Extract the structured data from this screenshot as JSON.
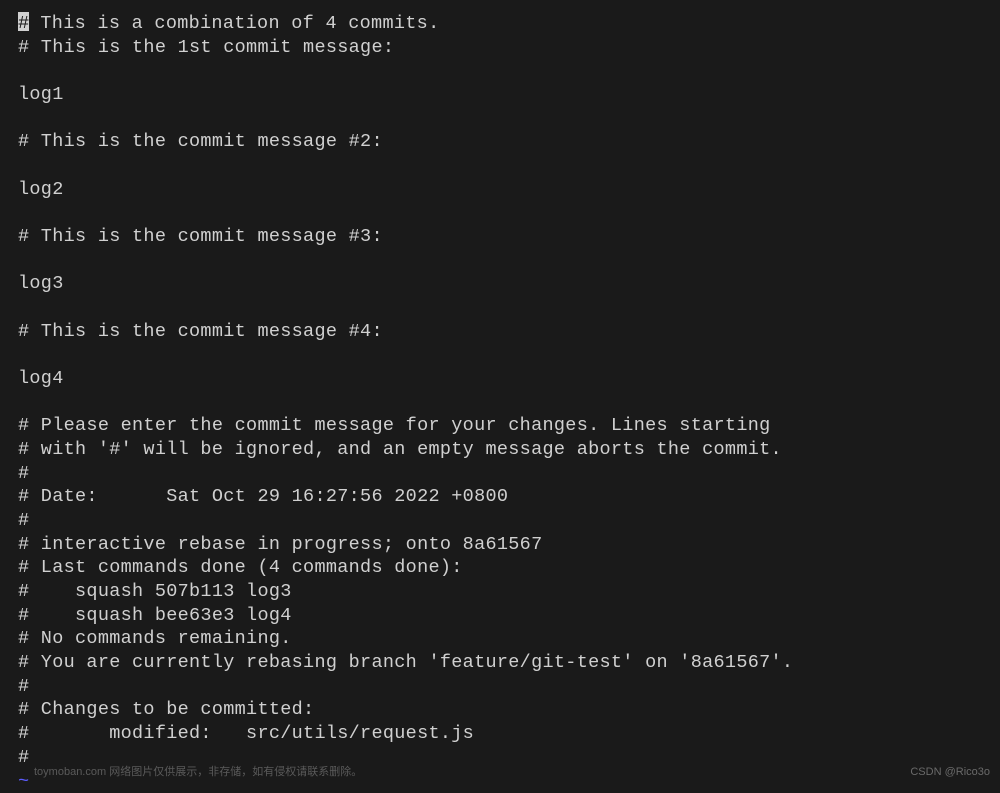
{
  "editor": {
    "lines": [
      "# This is a combination of 4 commits.",
      "# This is the 1st commit message:",
      "",
      "log1",
      "",
      "# This is the commit message #2:",
      "",
      "log2",
      "",
      "# This is the commit message #3:",
      "",
      "log3",
      "",
      "# This is the commit message #4:",
      "",
      "log4",
      "",
      "# Please enter the commit message for your changes. Lines starting",
      "# with '#' will be ignored, and an empty message aborts the commit.",
      "#",
      "# Date:      Sat Oct 29 16:27:56 2022 +0800",
      "#",
      "# interactive rebase in progress; onto 8a61567",
      "# Last commands done (4 commands done):",
      "#    squash 507b113 log3",
      "#    squash bee63e3 log4",
      "# No commands remaining.",
      "# You are currently rebasing branch 'feature/git-test' on '8a61567'.",
      "#",
      "# Changes to be committed:",
      "#       modified:   src/utils/request.js",
      "#"
    ],
    "cursor_char": "#",
    "tilde": "~"
  },
  "watermark_right": "CSDN @Rico3o",
  "watermark_left": "toymoban.com 网络图片仅供展示，非存储，如有侵权请联系删除。"
}
